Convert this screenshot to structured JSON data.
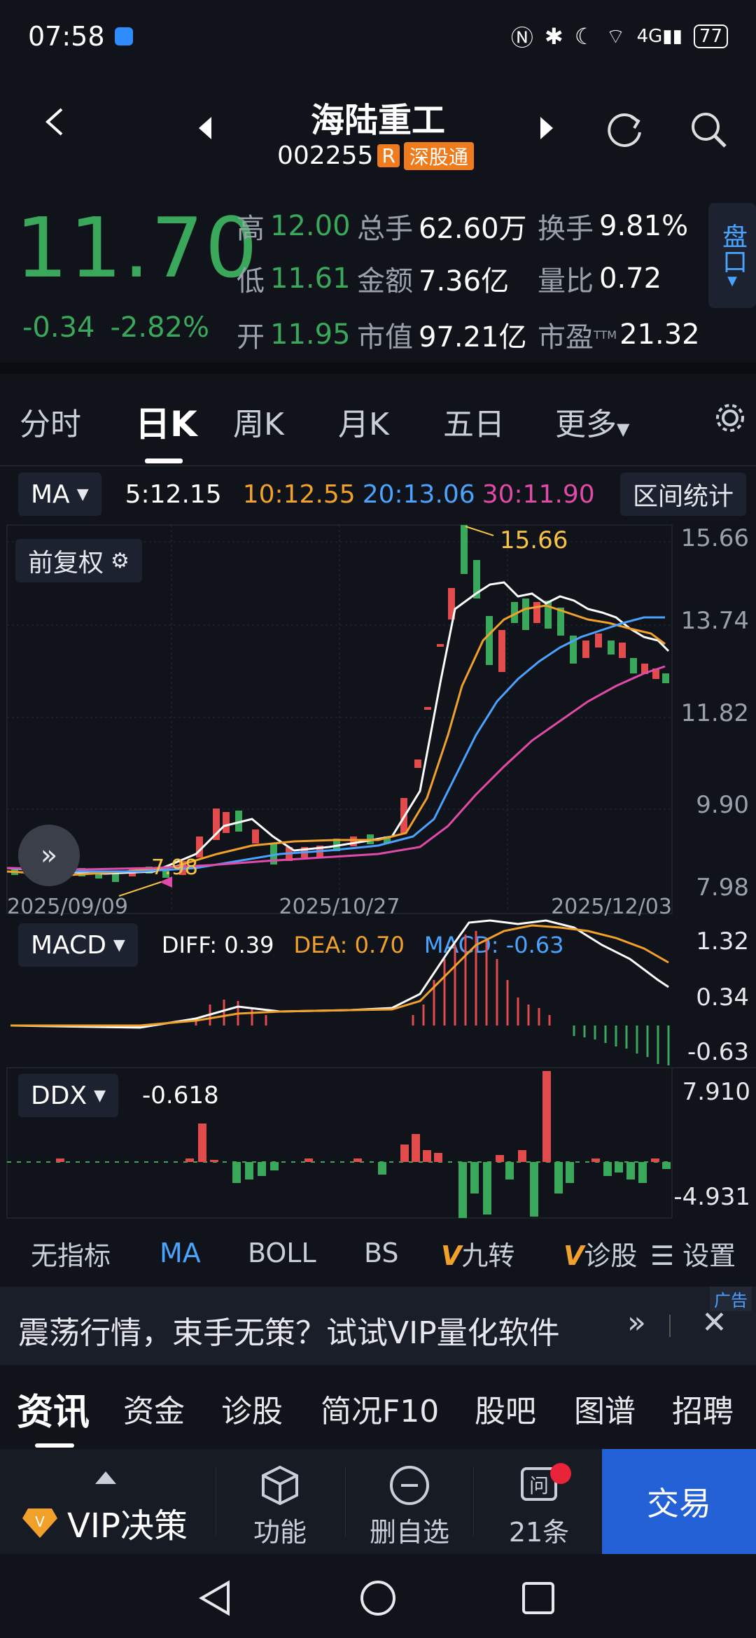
{
  "status": {
    "time": "07:58",
    "battery": "77"
  },
  "header": {
    "title": "海陆重工",
    "code": "002255",
    "tag_r": "R",
    "tag_exchange": "深股通"
  },
  "quote": {
    "price": "11.70",
    "change": "-0.34",
    "change_pct": "-2.82%",
    "high_label": "高",
    "high": "12.00",
    "low_label": "低",
    "low": "11.61",
    "open_label": "开",
    "open": "11.95",
    "vol_label": "总手",
    "vol": "62.60万",
    "amount_label": "金额",
    "amount": "7.36亿",
    "mcap_label": "市值",
    "mcap": "97.21亿",
    "turnover_label": "换手",
    "turnover": "9.81%",
    "ratio_label": "量比",
    "ratio": "0.72",
    "pe_label": "市盈",
    "pe_sup": "TTM",
    "pe": "21.32",
    "pankou": "盘口"
  },
  "period_tabs": [
    "分时",
    "日K",
    "周K",
    "月K",
    "五日",
    "更多"
  ],
  "active_tab": "日K",
  "ma_bar": {
    "label": "MA",
    "ma5": "5:12.15",
    "ma10": "10:12.55",
    "ma20": "20:13.06",
    "ma30": "30:11.90",
    "stat_btn": "区间统计"
  },
  "chart": {
    "adjust_label": "前复权",
    "high_mark": "15.66",
    "low_mark": "7.98",
    "dates": [
      "2025/09/09",
      "2025/10/27",
      "2025/12/03"
    ],
    "y_ticks": [
      "15.66",
      "13.74",
      "11.82",
      "9.90",
      "7.98"
    ]
  },
  "macd": {
    "label": "MACD",
    "diff": "DIFF: 0.39",
    "dea": "DEA: 0.70",
    "macd": "MACD: -0.63",
    "y_ticks": [
      "1.32",
      "0.34",
      "-0.63"
    ]
  },
  "ddx": {
    "label": "DDX",
    "value": "-0.618",
    "y_ticks": [
      "7.910",
      "-4.931"
    ]
  },
  "indicator_tabs": [
    "无指标",
    "MA",
    "BOLL",
    "BS",
    "九转",
    "诊股",
    "设置"
  ],
  "ad": {
    "text": "震荡行情，束手无策？试试VIP量化软件",
    "tag": "广告"
  },
  "info_tabs": [
    "资讯",
    "资金",
    "诊股",
    "简况F10",
    "股吧",
    "图谱",
    "招聘"
  ],
  "bottom": {
    "vip": "VIP决策",
    "func": "功能",
    "del": "删自选",
    "msg": "21条",
    "trade": "交易"
  },
  "colors": {
    "green": "#3aa85b",
    "red": "#e14b4b",
    "blue": "#4aa3ff"
  }
}
